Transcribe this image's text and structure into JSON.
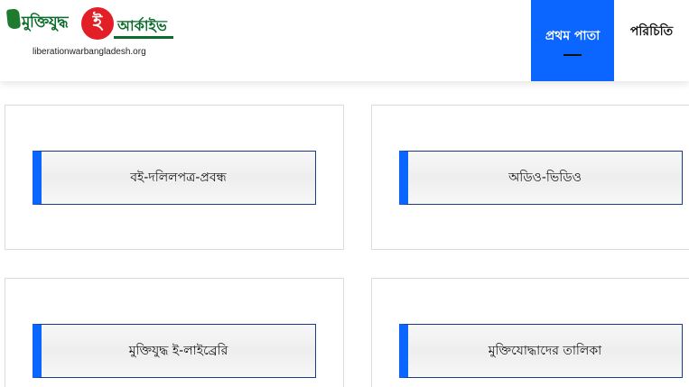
{
  "header": {
    "logo": {
      "word1": "মুক্তিযুদ্ধ",
      "circle_letter": "ই",
      "word2": "আর্কাইভ",
      "url": "liberationwarbangladesh.org"
    },
    "nav": {
      "home_label": "প্রথম পাতা",
      "about_label": "পরিচিতি"
    }
  },
  "cards": [
    {
      "label": "বই-দলিলপত্র-প্রবন্ধ"
    },
    {
      "label": "অডিও-ভিডিও"
    },
    {
      "label": "মুক্তিযুদ্ধ ই-লাইব্রেরি"
    },
    {
      "label": "মুক্তিযোদ্ধাদের তালিকা"
    }
  ],
  "colors": {
    "accent_blue": "#0a66ff",
    "logo_green": "#0b6b2a",
    "logo_red": "#e21f26",
    "link_border": "#1a3a8c"
  }
}
